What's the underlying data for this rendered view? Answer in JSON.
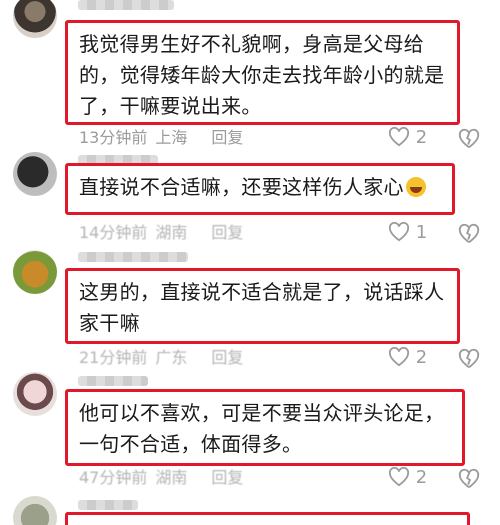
{
  "comments": [
    {
      "text": "我觉得男生好不礼貌啊，身高是父母给的，觉得矮年龄大你走去找年龄小的就是了，干嘛要说出来。",
      "time": "13分钟前",
      "location": "上海",
      "reply": "回复",
      "likes": "2"
    },
    {
      "text": "直接说不合适嘛，还要这样伤人家心",
      "time": "14分钟前",
      "location": "湖南",
      "reply": "回复",
      "likes": "1"
    },
    {
      "text": "这男的，直接说不适合就是了，说话踩人家干嘛",
      "time": "21分钟前",
      "location": "广东",
      "reply": "回复",
      "likes": "2"
    },
    {
      "text": "他可以不喜欢，可是不要当众评头论足，一句不合适，体面得多。",
      "time": "47分钟前",
      "location": "湖南",
      "reply": "回复",
      "likes": "2"
    }
  ],
  "colors": {
    "highlight_border": "#e0182a",
    "meta_text": "#9b9b9b"
  }
}
